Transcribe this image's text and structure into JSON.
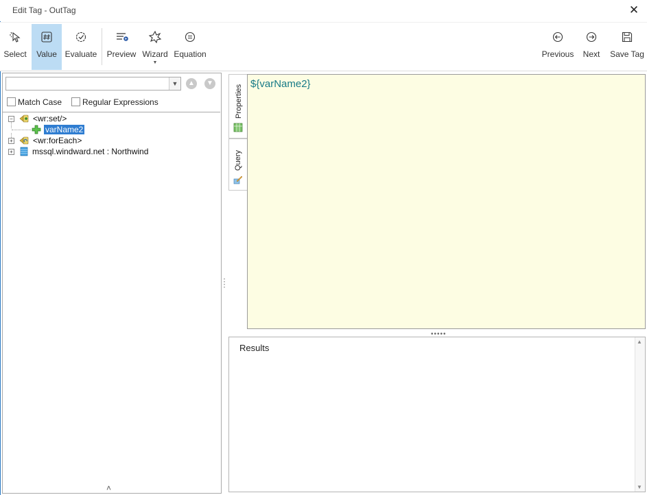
{
  "window": {
    "title": "Edit Tag - OutTag",
    "close_glyph": "✕"
  },
  "ribbon": {
    "buttons": [
      {
        "label": "Select",
        "icon": "cursor-icon",
        "active": false
      },
      {
        "label": "Value",
        "icon": "hash-icon",
        "active": true
      },
      {
        "label": "Evaluate",
        "icon": "check-circle-icon",
        "active": false
      },
      {
        "label": "Preview",
        "icon": "preview-icon",
        "active": false
      },
      {
        "label": "Wizard",
        "icon": "wizard-icon",
        "active": false
      },
      {
        "label": "Equation",
        "icon": "equals-circle-icon",
        "active": false
      },
      {
        "label": "Previous",
        "icon": "arrow-left-circle-icon",
        "active": false
      },
      {
        "label": "Next",
        "icon": "arrow-right-circle-icon",
        "active": false
      },
      {
        "label": "Save Tag",
        "icon": "save-icon",
        "active": false
      }
    ]
  },
  "search": {
    "value": "",
    "match_case_label": "Match Case",
    "regex_label": "Regular Expressions"
  },
  "tree": {
    "items": [
      {
        "label": "<wr:set/>",
        "expanded": true
      },
      {
        "label": "varName2",
        "selected": true
      },
      {
        "label": "<wr:forEach>",
        "expanded": false
      },
      {
        "label": "mssql.windward.net : Northwind",
        "expanded": false
      }
    ]
  },
  "tabs": {
    "properties": "Properties",
    "query": "Query"
  },
  "editor": {
    "text": "${varName2}"
  },
  "results": {
    "label": "Results"
  },
  "colors": {
    "active_button": "#bcdcf4",
    "editor_bg": "#fdfde3",
    "editor_text": "#177a87",
    "selection": "#2f7dd1",
    "window_border": "#2b79c4"
  }
}
